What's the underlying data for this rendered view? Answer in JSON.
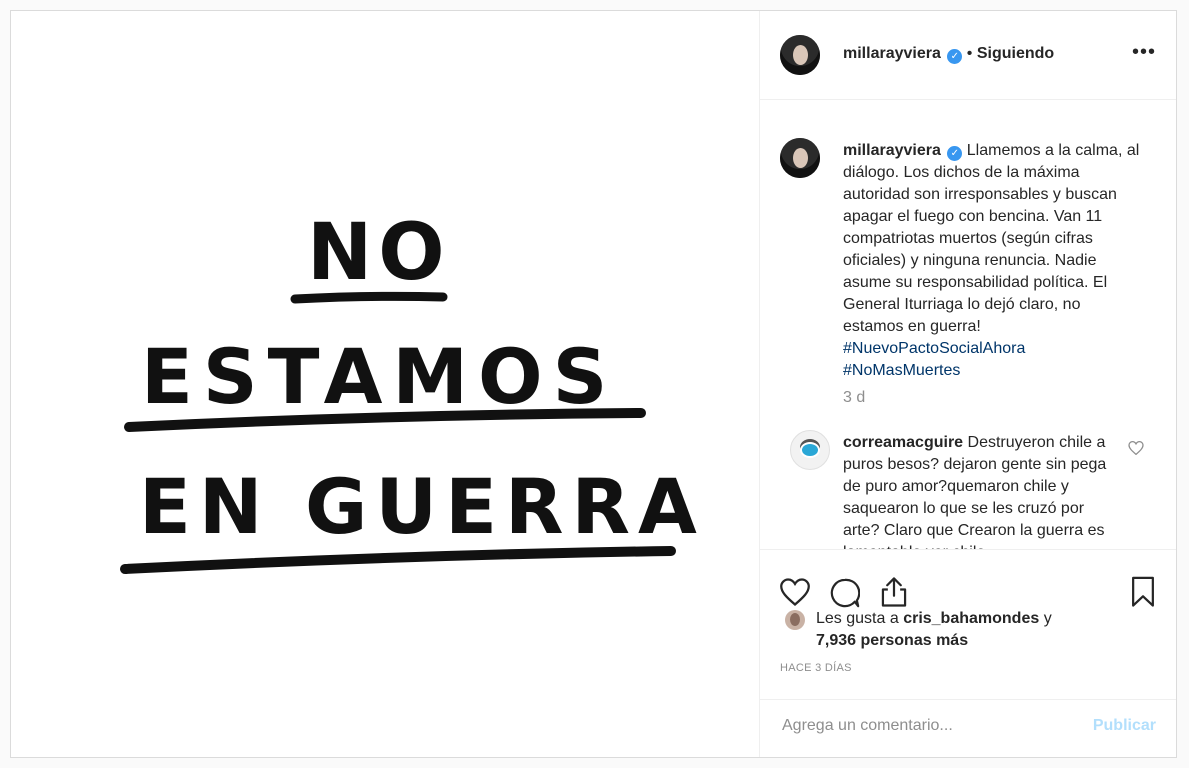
{
  "post": {
    "image_text": {
      "line1": "NO",
      "line2": "ESTAMOS",
      "line3": "EN GUERRA"
    },
    "author": {
      "username": "millarayviera",
      "verified_icon": "verified-badge-icon",
      "separator": "•",
      "follow_status": "Siguiendo"
    },
    "more_options": "•••",
    "caption": {
      "username": "millarayviera",
      "text": "Llamemos a la calma, al diálogo. Los dichos de la máxima autoridad son irresponsables y buscan apagar el fuego con bencina. Van 11 compatriotas muertos (según cifras oficiales) y ninguna renuncia. Nadie asume su responsabilidad política. El General Iturriaga lo dejó claro, no estamos en guerra!",
      "hashtags": [
        "#NuevoPactoSocialAhora",
        "#NoMasMuertes"
      ],
      "time": "3 d"
    },
    "comments": [
      {
        "username": "correamacguire",
        "text": "Destruyeron chile a puros besos? dejaron gente sin pega de puro amor?quemaron chile y saquearon lo que se les cruzó por arte? Claro que Crearon la guerra es lamentable ver chile"
      }
    ],
    "likes": {
      "prefix": "Les gusta a",
      "user": "cris_bahamondes",
      "joiner": "y",
      "others": "7,936 personas más"
    },
    "timestamp": "HACE 3 DÍAS",
    "comment_box": {
      "placeholder": "Agrega un comentario...",
      "publish_label": "Publicar"
    }
  },
  "colors": {
    "link": "#003569",
    "verified": "#3897f0",
    "publish_disabled": "#b2dffc",
    "muted": "#8e8e8e"
  }
}
